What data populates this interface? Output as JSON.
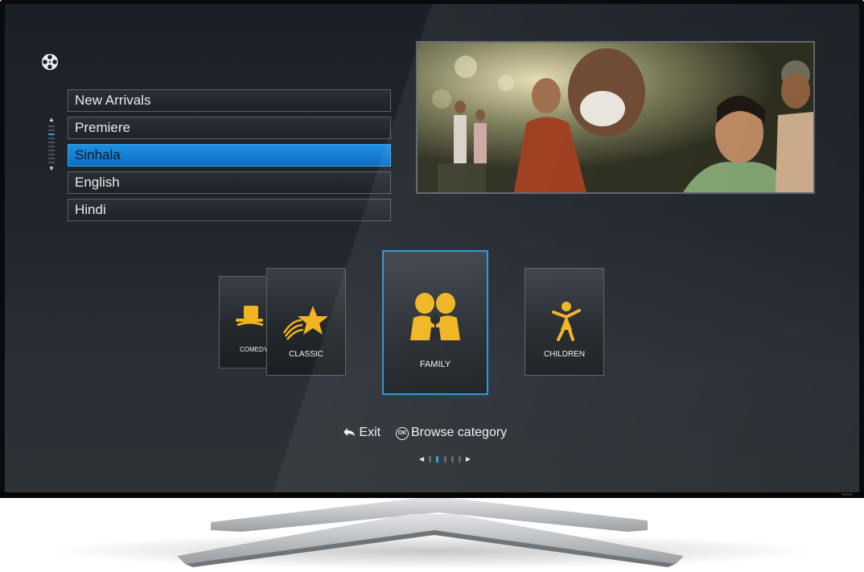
{
  "menu": {
    "items": [
      {
        "label": "New Arrivals",
        "selected": false
      },
      {
        "label": "Premiere",
        "selected": false
      },
      {
        "label": "Sinhala",
        "selected": true
      },
      {
        "label": "English",
        "selected": false
      },
      {
        "label": "Hindi",
        "selected": false
      }
    ],
    "scroll_active_index": 2
  },
  "categories": {
    "comedy": {
      "label": "COMEDY",
      "icon": "hat-icon"
    },
    "classic": {
      "label": "CLASSIC",
      "icon": "star-icon"
    },
    "family": {
      "label": "FAMILY",
      "icon": "family-icon",
      "focused": true
    },
    "children": {
      "label": "CHILDREN",
      "icon": "child-icon"
    }
  },
  "hints": {
    "exit": "Exit",
    "ok_badge": "OK",
    "browse": "Browse category"
  },
  "pager": {
    "pages": 5,
    "active": 1
  },
  "colors": {
    "accent": "#1a8ae0",
    "icon_gold": "#f0b41e",
    "text": "#eef1f4"
  }
}
